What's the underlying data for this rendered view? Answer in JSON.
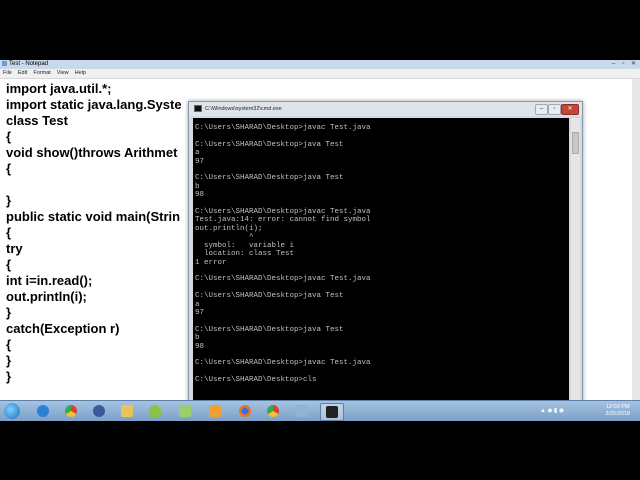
{
  "notepad": {
    "title": "Test - Notepad",
    "menu": [
      "File",
      "Edit",
      "Format",
      "View",
      "Help"
    ],
    "lines": [
      "import java.util.*;",
      "import static java.lang.Syste",
      "class Test",
      "{",
      "void show()throws Arithmet",
      "{",
      "",
      "}",
      "public static void main(Strin",
      "{",
      "try",
      "{",
      "int i=in.read();",
      "out.println(i);",
      "}",
      "catch(Exception r)",
      "{",
      "}",
      "}"
    ]
  },
  "cmd": {
    "title": "C:\\Windows\\system32\\cmd.exe",
    "output": "C:\\Users\\SHARAD\\Desktop>javac Test.java\n\nC:\\Users\\SHARAD\\Desktop>java Test\na\n97\n\nC:\\Users\\SHARAD\\Desktop>java Test\nb\n98\n\nC:\\Users\\SHARAD\\Desktop>javac Test.java\nTest.java:14: error: cannot find symbol\nout.println(i);\n            ^\n  symbol:   variable i\n  location: class Test\n1 error\n\nC:\\Users\\SHARAD\\Desktop>javac Test.java\n\nC:\\Users\\SHARAD\\Desktop>java Test\na\n97\n\nC:\\Users\\SHARAD\\Desktop>java Test\nb\n98\n\nC:\\Users\\SHARAD\\Desktop>javac Test.java\n\nC:\\Users\\SHARAD\\Desktop>cls"
  },
  "taskbar": {
    "apps": [
      {
        "name": "start-orb",
        "color": "#1b6fc2"
      },
      {
        "name": "ie-icon",
        "color": "#2d7fd6"
      },
      {
        "name": "chrome-icon",
        "color": "#d9412f"
      },
      {
        "name": "media-icon",
        "color": "#3b5a9a"
      },
      {
        "name": "explorer-icon",
        "color": "#e6c35c"
      },
      {
        "name": "android-icon",
        "color": "#8bc34a"
      },
      {
        "name": "folder-icon",
        "color": "#9ad06a"
      },
      {
        "name": "media-player-icon",
        "color": "#f0a030"
      },
      {
        "name": "firefox-icon",
        "color": "#e8742a"
      },
      {
        "name": "chrome-alt-icon",
        "color": "#d9412f"
      },
      {
        "name": "notepad-icon",
        "color": "#8fb4d8"
      },
      {
        "name": "cmd-icon",
        "color": "#222222"
      }
    ],
    "time": "12:03 PM",
    "date": "3/25/2018"
  }
}
